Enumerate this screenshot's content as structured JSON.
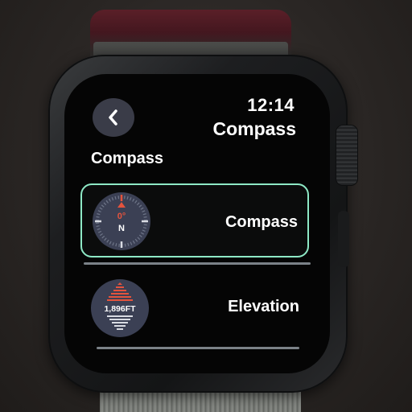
{
  "status": {
    "time": "12:14"
  },
  "header": {
    "app_title": "Compass",
    "back_icon": "chevron-left-icon"
  },
  "section": {
    "title": "Compass"
  },
  "rows": [
    {
      "label": "Compass",
      "icon": "compass-complication-icon",
      "heading": "0°",
      "direction": "N",
      "selected": true
    },
    {
      "label": "Elevation",
      "icon": "elevation-complication-icon",
      "value": "1,896FT"
    }
  ],
  "colors": {
    "selection_border": "#8ee9c6",
    "icon_background": "#3b4054",
    "accent_red": "#e4533d",
    "back_button_bg": "#3a3c48"
  }
}
